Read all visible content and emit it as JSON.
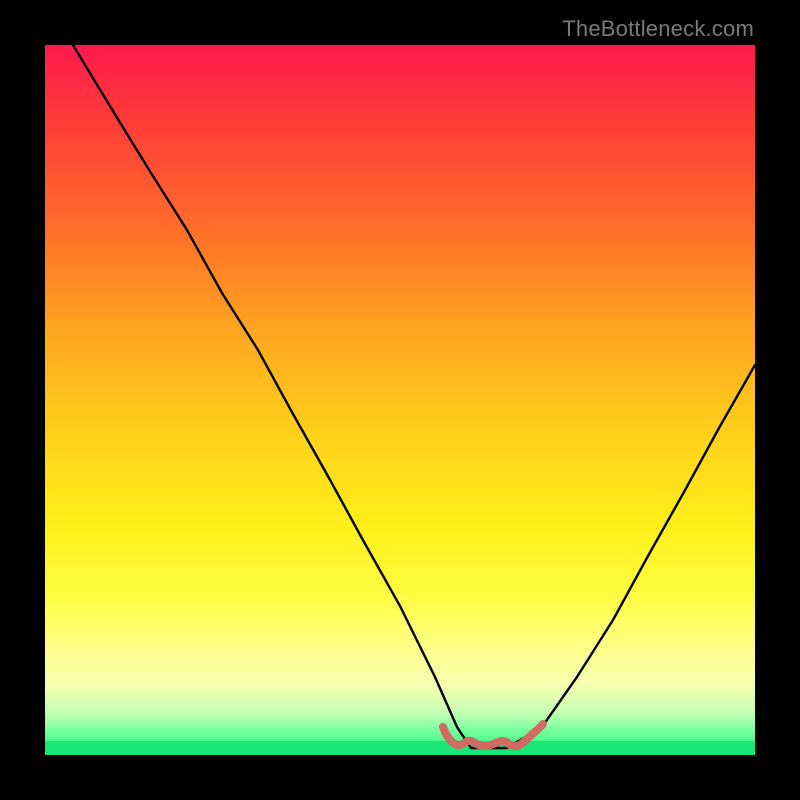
{
  "watermark": "TheBottleneck.com",
  "chart_data": {
    "type": "line",
    "title": "",
    "xlabel": "",
    "ylabel": "",
    "xlim": [
      0,
      100
    ],
    "ylim": [
      0,
      100
    ],
    "grid": false,
    "legend": false,
    "series": [
      {
        "name": "bottleneck-curve",
        "x": [
          4,
          10,
          15,
          20,
          25,
          30,
          35,
          40,
          45,
          50,
          55,
          58,
          60,
          62,
          65,
          70,
          75,
          80,
          85,
          90,
          95,
          100
        ],
        "values": [
          100,
          90,
          82,
          74,
          65,
          57,
          48,
          39,
          30,
          21,
          11,
          4,
          1,
          1,
          1,
          4,
          11,
          19,
          28,
          37,
          46,
          55
        ]
      },
      {
        "name": "flat-zone-marker",
        "x": [
          56,
          58,
          60,
          62,
          64,
          66,
          68,
          70
        ],
        "values": [
          4,
          2.5,
          1.5,
          1.2,
          1.5,
          2,
          3,
          4.5
        ]
      }
    ],
    "gradient_stops": [
      {
        "pos": 0,
        "color": "#ff1a4d"
      },
      {
        "pos": 25,
        "color": "#ff6a2a"
      },
      {
        "pos": 55,
        "color": "#ffd11a"
      },
      {
        "pos": 85,
        "color": "#ffff8a"
      },
      {
        "pos": 100,
        "color": "#18e873"
      }
    ]
  }
}
